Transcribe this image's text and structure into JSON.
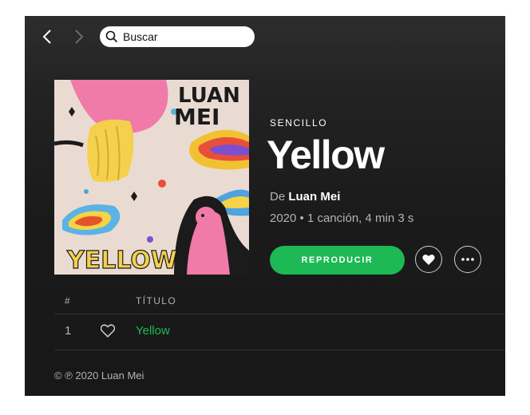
{
  "nav": {
    "back_icon": "chevron-left-icon",
    "forward_icon": "chevron-right-icon"
  },
  "search": {
    "value": "",
    "placeholder": "Buscar",
    "icon": "search-icon"
  },
  "album": {
    "cover_text_top": "LUAN MEI",
    "cover_text_bottom": "YELLOW",
    "type_label": "SENCILLO",
    "title": "Yellow",
    "by_prefix": "De",
    "artist": "Luan Mei",
    "meta": "2020 • 1 canción, 4 min 3 s"
  },
  "actions": {
    "play_label": "REPRODUCIR",
    "like_icon": "heart-filled-icon",
    "more_icon": "more-icon"
  },
  "tracklist": {
    "headers": {
      "number": "#",
      "title": "TÍTULO"
    },
    "tracks": [
      {
        "number": "1",
        "title": "Yellow"
      }
    ]
  },
  "footer": {
    "copyright": "© ℗ 2020 Luan Mei"
  },
  "colors": {
    "accent": "#1db954",
    "background": "#181818",
    "text_secondary": "#b3b3b3"
  }
}
